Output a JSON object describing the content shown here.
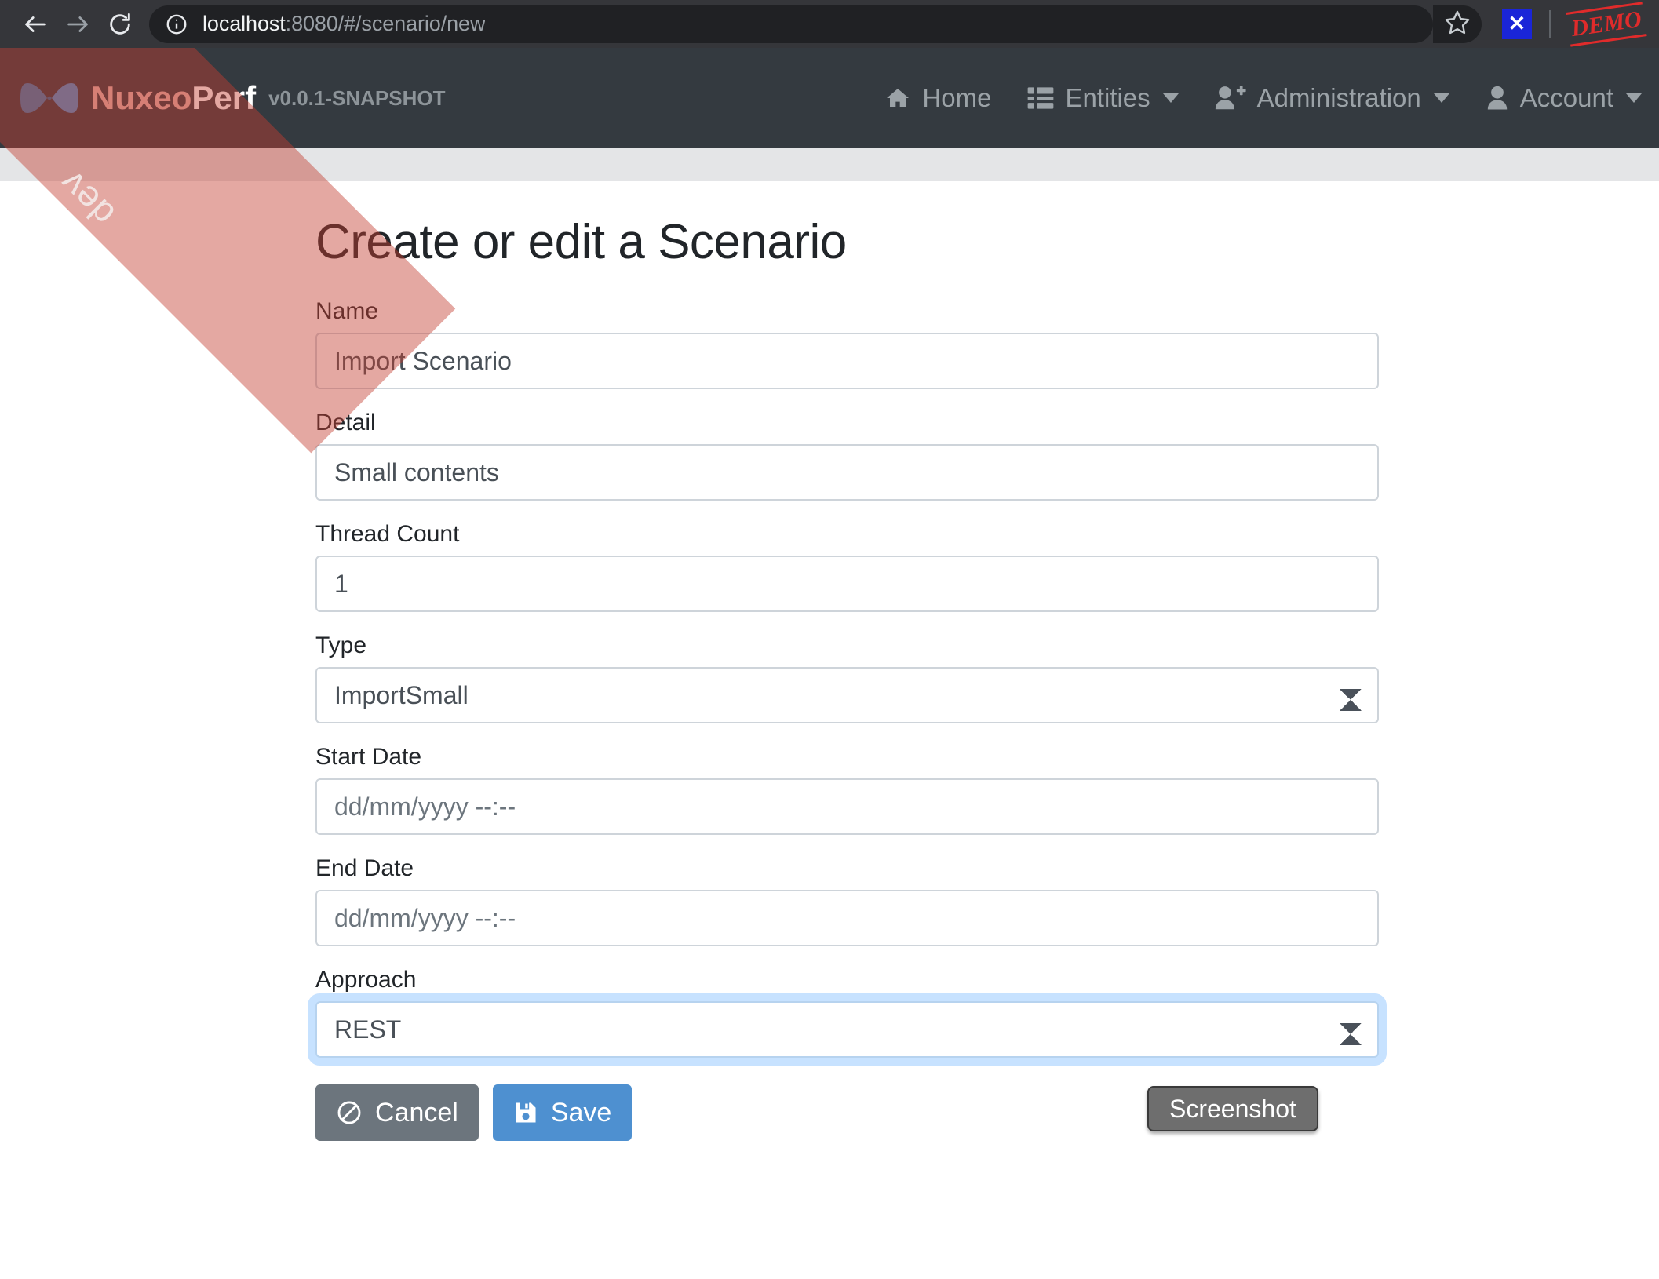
{
  "browser": {
    "back_icon": "back-arrow-icon",
    "forward_icon": "forward-arrow-icon",
    "reload_icon": "reload-icon",
    "site_info_icon": "info-circle-icon",
    "url_host": "localhost",
    "url_rest": ":8080/#/scenario/new",
    "url_full": "localhost:8080/#/scenario/new",
    "bookmark_icon": "star-outline-icon",
    "extension_icon": "x-close-icon",
    "extension_label": "✕",
    "stamp_label": "DEMO"
  },
  "navbar": {
    "logo_icon": "nuxeo-bowtie-logo",
    "brand_first": "Nuxeo",
    "brand_second": "Perf",
    "version": "v0.0.1-SNAPSHOT",
    "ribbon_label": "dev",
    "links": [
      {
        "label": "Home",
        "icon": "home-icon",
        "has_caret": false
      },
      {
        "label": "Entities",
        "icon": "list-icon",
        "has_caret": true
      },
      {
        "label": "Administration",
        "icon": "user-plus-icon",
        "has_caret": true
      },
      {
        "label": "Account",
        "icon": "user-icon",
        "has_caret": true
      }
    ]
  },
  "page": {
    "title": "Create or edit a Scenario"
  },
  "form": {
    "fields": [
      {
        "label": "Name",
        "value": "Import Scenario",
        "placeholder": ""
      },
      {
        "label": "Detail",
        "value": "Small contents",
        "placeholder": ""
      },
      {
        "label": "Thread Count",
        "value": "1",
        "placeholder": ""
      },
      {
        "label": "Type",
        "value": "ImportSmall",
        "placeholder": ""
      },
      {
        "label": "Start Date",
        "value": "",
        "placeholder": "dd/mm/yyyy --:--"
      },
      {
        "label": "End Date",
        "value": "",
        "placeholder": "dd/mm/yyyy --:--"
      },
      {
        "label": "Approach",
        "value": "REST",
        "placeholder": ""
      }
    ],
    "type_options": [
      "ImportSmall"
    ],
    "approach_options": [
      "REST"
    ],
    "date_placeholder": "dd/mm/yyyy --:--"
  },
  "actions": {
    "cancel_label": "Cancel",
    "cancel_icon": "ban-icon",
    "save_label": "Save",
    "save_icon": "floppy-disk-icon",
    "screenshot_label": "Screenshot"
  },
  "colors": {
    "navbar_bg": "#343a40",
    "brand_accent": "#e6b4ae",
    "primary": "#4e90d0",
    "secondary": "#6c757d",
    "ribbon": "#c43e30",
    "chrome_bg": "#35363a",
    "omnibox_bg": "#202124",
    "stamp_red": "#e02b2b"
  }
}
